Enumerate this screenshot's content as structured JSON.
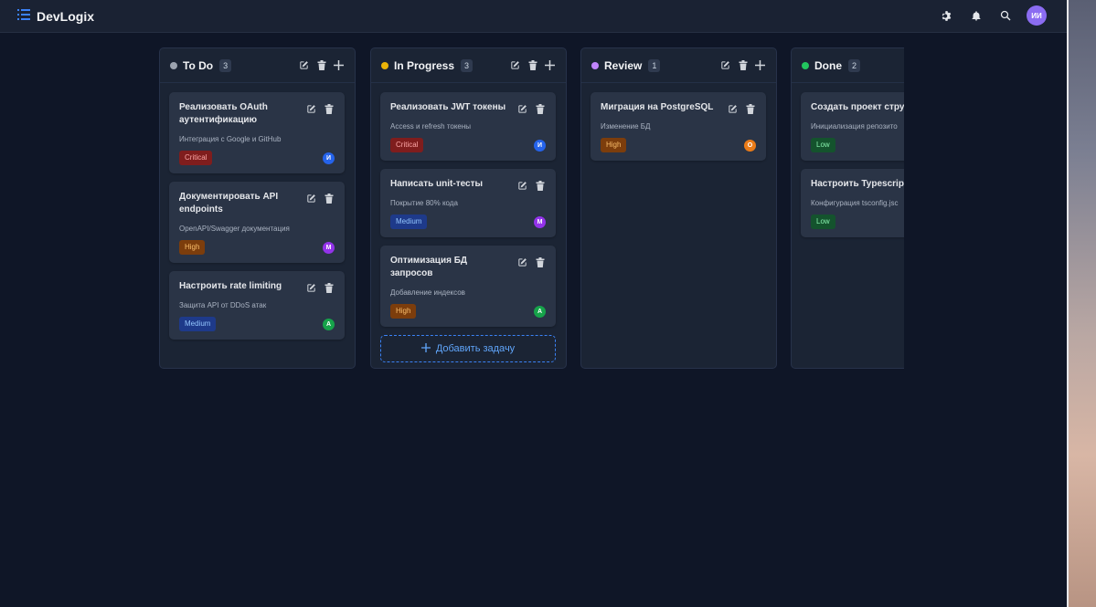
{
  "app": {
    "name": "DevLogix"
  },
  "topbar": {
    "avatar_initials": "ИИ"
  },
  "actions": {
    "add_task_label": "Добавить задачу"
  },
  "columns": [
    {
      "title": "To Do",
      "count": "3",
      "dot_color": "#9ca3af",
      "cards": [
        {
          "title": "Реализовать OAuth аутентификацию",
          "desc": "Интеграция с Google и GitHub",
          "priority": "Critical",
          "avatar": "И",
          "avatar_color": "#2563eb"
        },
        {
          "title": "Документировать API endpoints",
          "desc": "OpenAPI/Swagger документация",
          "priority": "High",
          "avatar": "М",
          "avatar_color": "#9333ea"
        },
        {
          "title": "Настроить rate limiting",
          "desc": "Защита API от DDoS атак",
          "priority": "Medium",
          "avatar": "А",
          "avatar_color": "#16a34a"
        }
      ]
    },
    {
      "title": "In Progress",
      "count": "3",
      "dot_color": "#eab308",
      "cards": [
        {
          "title": "Реализовать JWT токены",
          "desc": "Access и refresh токены",
          "priority": "Critical",
          "avatar": "И",
          "avatar_color": "#2563eb"
        },
        {
          "title": "Написать unit-тесты",
          "desc": "Покрытие 80% кода",
          "priority": "Medium",
          "avatar": "М",
          "avatar_color": "#9333ea"
        },
        {
          "title": "Оптимизация БД запросов",
          "desc": "Добавление индексов",
          "priority": "High",
          "avatar": "А",
          "avatar_color": "#16a34a"
        }
      ]
    },
    {
      "title": "Review",
      "count": "1",
      "dot_color": "#c084fc",
      "cards": [
        {
          "title": "Миграция на PostgreSQL",
          "desc": "Изменение БД",
          "priority": "High",
          "avatar": "О",
          "avatar_color": "#ea7b18"
        }
      ]
    },
    {
      "title": "Done",
      "count": "2",
      "dot_color": "#22c55e",
      "cards": [
        {
          "title": "Создать проект струк",
          "desc": "Инициализация репозито",
          "priority": "Low",
          "avatar": "",
          "avatar_color": "#16a34a"
        },
        {
          "title": "Настроить Typescript",
          "desc": "Конфигурация tsconfig.jsc",
          "priority": "Low",
          "avatar": "",
          "avatar_color": "#16a34a"
        }
      ]
    }
  ]
}
